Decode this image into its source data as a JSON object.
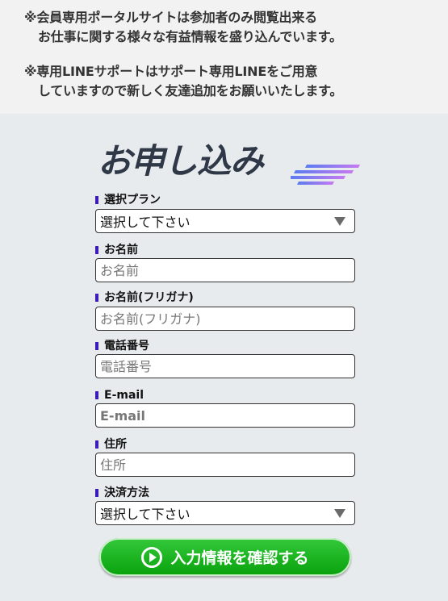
{
  "notice": {
    "line1": "※会員専用ポータルサイトは参加者のみ閲覧出来る",
    "line2": "お仕事に関する様々な有益情報を盛り込んでいます。",
    "line3": "※専用LINEサポートはサポート専用LINEをご用意",
    "line4": "していますので新しく友達追加をお願いいたします。"
  },
  "form": {
    "title": "お申し込み",
    "plan": {
      "label": "選択プラン",
      "value": "選択して下さい"
    },
    "name": {
      "label": "お名前",
      "placeholder": "お名前"
    },
    "kana": {
      "label": "お名前(フリガナ)",
      "placeholder": "お名前(フリガナ)"
    },
    "phone": {
      "label": "電話番号",
      "placeholder": "電話番号"
    },
    "email": {
      "label": "E-mail",
      "placeholder": "E-mail"
    },
    "address": {
      "label": "住所",
      "placeholder": "住所"
    },
    "payment": {
      "label": "決済方法",
      "value": "選択して下さい"
    },
    "submit_label": "入力情報を確認する"
  },
  "colors": {
    "label_mark": "#3b1cb8",
    "submit_green": "#13b016",
    "title": "#2f3847"
  }
}
